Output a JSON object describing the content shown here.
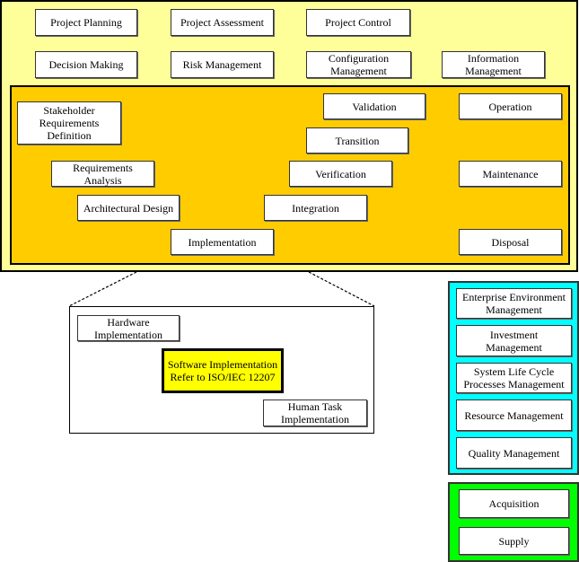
{
  "colors": {
    "outer_panel": "#FFFF99",
    "inner_panel": "#FFCC00",
    "software_box": "#FFFF00",
    "enterprise_panel": "#00FFFF",
    "agreement_panel": "#00FF00"
  },
  "project_processes": [
    "Project Planning",
    "Project Assessment",
    "Project Control",
    "Decision Making",
    "Risk Management",
    "Configuration\nManagement",
    "Information\nManagement"
  ],
  "technical_processes": [
    "Stakeholder\nRequirements\nDefinition",
    "Validation",
    "Operation",
    "Transition",
    "Requirements\nAnalysis",
    "Verification",
    "Maintenance",
    "Architectural Design",
    "Integration",
    "Implementation",
    "Disposal"
  ],
  "implementation_detail": [
    "Hardware\nImplementation",
    "Software Implementation\nRefer to ISO/IEC 12207",
    "Human Task\nImplementation"
  ],
  "enterprise_processes": [
    "Enterprise Environment\nManagement",
    "Investment\nManagement",
    "System Life Cycle\nProcesses Management",
    "Resource Management",
    "Quality Management"
  ],
  "agreement_processes": [
    "Acquisition",
    "Supply"
  ]
}
